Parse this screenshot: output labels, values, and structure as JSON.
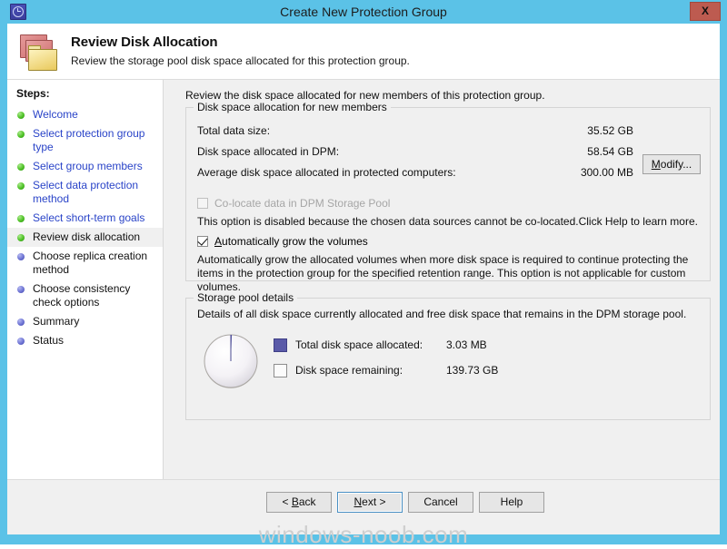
{
  "window": {
    "title": "Create New Protection Group",
    "app_icon": "dpm-clock-icon",
    "close_label": "X",
    "frame_color": "#5bc2e7"
  },
  "header": {
    "icon": "folders-icon",
    "title": "Review Disk Allocation",
    "subtitle": "Review the storage pool disk space allocated for this protection group."
  },
  "sidebar": {
    "heading": "Steps:",
    "items": [
      {
        "label": "Welcome",
        "state": "done"
      },
      {
        "label": "Select protection group type",
        "state": "done"
      },
      {
        "label": "Select group members",
        "state": "done"
      },
      {
        "label": "Select data protection method",
        "state": "done"
      },
      {
        "label": "Select short-term goals",
        "state": "done"
      },
      {
        "label": "Review disk allocation",
        "state": "current"
      },
      {
        "label": "Choose replica creation method",
        "state": "todo"
      },
      {
        "label": "Choose consistency check options",
        "state": "todo"
      },
      {
        "label": "Summary",
        "state": "todo"
      },
      {
        "label": "Status",
        "state": "todo"
      }
    ]
  },
  "content": {
    "intro": "Review the disk space allocated for new members of this protection group.",
    "allocation_group": {
      "title": "Disk space allocation for new members",
      "rows": [
        {
          "label": "Total data size:",
          "value": "35.52 GB"
        },
        {
          "label": "Disk space allocated in DPM:",
          "value": "58.54 GB"
        },
        {
          "label": "Average disk space allocated in protected computers:",
          "value": "300.00 MB"
        }
      ],
      "modify_button": {
        "accel": "M",
        "rest": "odify..."
      },
      "colocate_checkbox": {
        "label": "Co-locate data in DPM Storage Pool",
        "checked": false,
        "disabled": true
      },
      "colocate_note": "This option is disabled because the chosen data sources cannot be co-located.Click Help to learn more.",
      "autogrow_checkbox": {
        "accel": "A",
        "rest": "utomatically grow the volumes",
        "checked": true,
        "disabled": false
      },
      "autogrow_note": "Automatically grow the allocated volumes when more disk space is required to continue protecting the items in the protection group for the specified retention range. This option is not applicable for custom volumes."
    },
    "pool_group": {
      "title": "Storage pool details",
      "description": "Details of all disk space currently allocated and free disk space that remains in the DPM storage pool.",
      "legend": [
        {
          "label": "Total disk space allocated:",
          "value": "3.03 MB",
          "color": "#5a5aa8"
        },
        {
          "label": "Disk space remaining:",
          "value": "139.73 GB",
          "color": "#fbfbfb"
        }
      ]
    }
  },
  "chart_data": {
    "type": "pie",
    "title": "Storage pool details",
    "categories": [
      "Total disk space allocated",
      "Disk space remaining"
    ],
    "values": [
      0.00303,
      139.73
    ],
    "units": "GB",
    "display_values": [
      "3.03 MB",
      "139.73 GB"
    ],
    "colors": [
      "#5a5aa8",
      "#fbfbfb"
    ],
    "legend_position": "right",
    "start_angle_deg": 0,
    "grid": false
  },
  "footer": {
    "buttons": [
      {
        "name": "back",
        "prefix": "< ",
        "accel": "B",
        "rest": "ack",
        "suffix": "",
        "default": false
      },
      {
        "name": "next",
        "prefix": "",
        "accel": "N",
        "rest": "ext",
        "suffix": " >",
        "default": true
      },
      {
        "name": "cancel",
        "prefix": "",
        "accel": "",
        "rest": "Cancel",
        "suffix": "",
        "default": false
      },
      {
        "name": "help",
        "prefix": "",
        "accel": "",
        "rest": "Help",
        "suffix": "",
        "default": false
      }
    ]
  },
  "watermark": "windows-noob.com"
}
